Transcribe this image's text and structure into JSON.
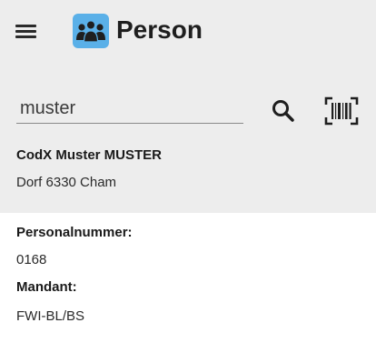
{
  "app_bar": {
    "title": "Person",
    "menu_icon": "hamburger-menu-icon",
    "app_icon": "people-group-icon",
    "app_icon_color": "#5ab0e8"
  },
  "search": {
    "value": "muster",
    "search_icon": "search-icon",
    "barcode_icon": "barcode-scan-icon"
  },
  "result": {
    "name": "CodX Muster MUSTER",
    "address": "Dorf 6330 Cham"
  },
  "details": {
    "personalnummer_label": "Personalnummer:",
    "personalnummer_value": "0168",
    "mandant_label": "Mandant:",
    "mandant_value": "FWI-BL/BS"
  },
  "colors": {
    "top_panel_bg": "#ededed",
    "page_bg": "#ffffff"
  }
}
